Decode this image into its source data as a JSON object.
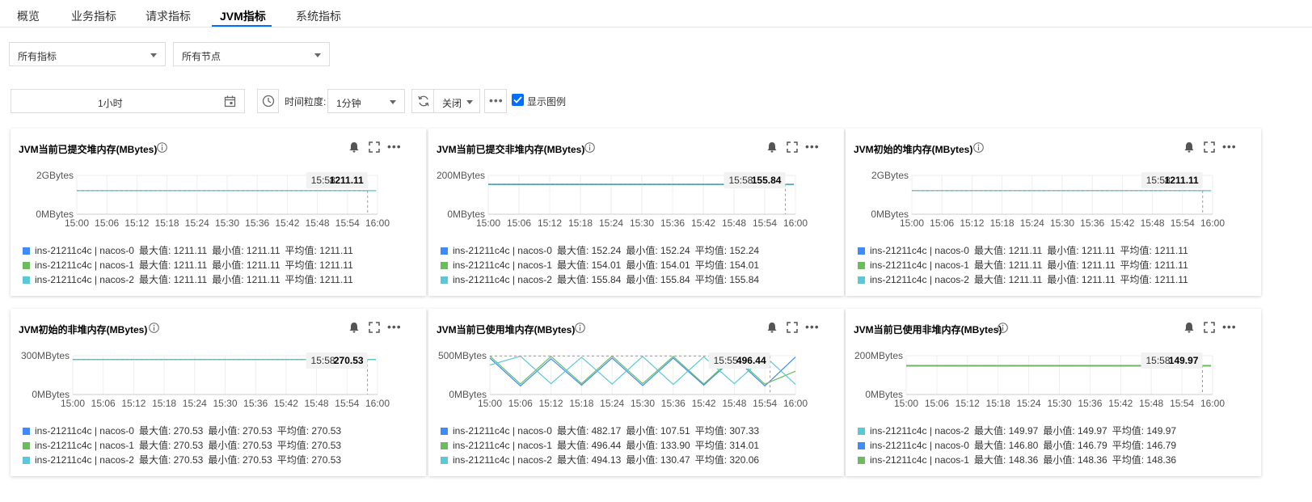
{
  "tabs": [
    "概览",
    "业务指标",
    "请求指标",
    "JVM指标",
    "系统指标"
  ],
  "active_tab": 3,
  "filters": {
    "metric_select": "所有指标",
    "node_select": "所有节点"
  },
  "toolbar": {
    "time_range": "1小时",
    "granularity_label": "时间粒度:",
    "granularity_value": "1分钟",
    "refresh_value": "关闭",
    "show_legend_label": "显示图例",
    "show_legend_checked": true
  },
  "colors": {
    "accent": "#006eff",
    "series": [
      "#3d8bfd",
      "#6cbc5e",
      "#5ac8d8"
    ]
  },
  "x_ticks": [
    "15:00",
    "15:06",
    "15:12",
    "15:18",
    "15:24",
    "15:30",
    "15:36",
    "15:42",
    "15:48",
    "15:54",
    "16:00"
  ],
  "cards": [
    {
      "title": "JVM当前已提交堆内存(MBytes)",
      "y_top": "2GBytes",
      "y_bottom": "0MBytes",
      "tooltip_time": "15:58",
      "tooltip_value": "1211.11",
      "legend": [
        {
          "name": "ins-21211c4c | nacos-0",
          "max": "最大值: 1211.11",
          "min": "最小值: 1211.11",
          "avg": "平均值: 1211.11"
        },
        {
          "name": "ins-21211c4c | nacos-1",
          "max": "最大值: 1211.11",
          "min": "最小值: 1211.11",
          "avg": "平均值: 1211.11"
        },
        {
          "name": "ins-21211c4c | nacos-2",
          "max": "最大值: 1211.11",
          "min": "最小值: 1211.11",
          "avg": "平均值: 1211.11"
        }
      ]
    },
    {
      "title": "JVM当前已提交非堆内存(MBytes)",
      "y_top": "200MBytes",
      "y_bottom": "0MBytes",
      "tooltip_time": "15:58",
      "tooltip_value": "155.84",
      "legend": [
        {
          "name": "ins-21211c4c | nacos-0",
          "max": "最大值: 152.24",
          "min": "最小值: 152.24",
          "avg": "平均值: 152.24"
        },
        {
          "name": "ins-21211c4c | nacos-1",
          "max": "最大值: 154.01",
          "min": "最小值: 154.01",
          "avg": "平均值: 154.01"
        },
        {
          "name": "ins-21211c4c | nacos-2",
          "max": "最大值: 155.84",
          "min": "最小值: 155.84",
          "avg": "平均值: 155.84"
        }
      ]
    },
    {
      "title": "JVM初始的堆内存(MBytes)",
      "y_top": "2GBytes",
      "y_bottom": "0MBytes",
      "tooltip_time": "15:58",
      "tooltip_value": "1211.11",
      "legend": [
        {
          "name": "ins-21211c4c | nacos-0",
          "max": "最大值: 1211.11",
          "min": "最小值: 1211.11",
          "avg": "平均值: 1211.11"
        },
        {
          "name": "ins-21211c4c | nacos-1",
          "max": "最大值: 1211.11",
          "min": "最小值: 1211.11",
          "avg": "平均值: 1211.11"
        },
        {
          "name": "ins-21211c4c | nacos-2",
          "max": "最大值: 1211.11",
          "min": "最小值: 1211.11",
          "avg": "平均值: 1211.11"
        }
      ]
    },
    {
      "title": "JVM初始的非堆内存(MBytes)",
      "y_top": "300MBytes",
      "y_bottom": "0MBytes",
      "tooltip_time": "15:58",
      "tooltip_value": "270.53",
      "legend": [
        {
          "name": "ins-21211c4c | nacos-0",
          "max": "最大值: 270.53",
          "min": "最小值: 270.53",
          "avg": "平均值: 270.53"
        },
        {
          "name": "ins-21211c4c | nacos-1",
          "max": "最大值: 270.53",
          "min": "最小值: 270.53",
          "avg": "平均值: 270.53"
        },
        {
          "name": "ins-21211c4c | nacos-2",
          "max": "最大值: 270.53",
          "min": "最小值: 270.53",
          "avg": "平均值: 270.53"
        }
      ]
    },
    {
      "title": "JVM当前已使用堆内存(MBytes)",
      "y_top": "500MBytes",
      "y_bottom": "0MBytes",
      "tooltip_time": "15:55",
      "tooltip_value": "496.44",
      "legend": [
        {
          "name": "ins-21211c4c | nacos-0",
          "max": "最大值: 482.17",
          "min": "最小值: 107.51",
          "avg": "平均值: 307.33"
        },
        {
          "name": "ins-21211c4c | nacos-1",
          "max": "最大值: 496.44",
          "min": "最小值: 133.90",
          "avg": "平均值: 314.01"
        },
        {
          "name": "ins-21211c4c | nacos-2",
          "max": "最大值: 494.13",
          "min": "最小值: 130.47",
          "avg": "平均值: 320.06"
        }
      ]
    },
    {
      "title": "JVM当前已使用非堆内存(MBytes)",
      "y_top": "200MBytes",
      "y_bottom": "0MBytes",
      "tooltip_time": "15:58",
      "tooltip_value": "149.97",
      "legend": [
        {
          "name": "ins-21211c4c | nacos-2",
          "max": "最大值: 149.97",
          "min": "最小值: 149.97",
          "avg": "平均值: 149.97"
        },
        {
          "name": "ins-21211c4c | nacos-0",
          "max": "最大值: 146.80",
          "min": "最小值: 146.79",
          "avg": "平均值: 146.79"
        },
        {
          "name": "ins-21211c4c | nacos-1",
          "max": "最大值: 148.36",
          "min": "最小值: 148.36",
          "avg": "平均值: 148.36"
        }
      ]
    }
  ],
  "chart_data": [
    {
      "type": "line",
      "title": "JVM当前已提交堆内存(MBytes)",
      "x": [
        "15:00",
        "15:06",
        "15:12",
        "15:18",
        "15:24",
        "15:30",
        "15:36",
        "15:42",
        "15:48",
        "15:54",
        "16:00"
      ],
      "ylim": [
        0,
        2000
      ],
      "series": [
        {
          "name": "ins-21211c4c | nacos-0",
          "values": [
            1211.11,
            1211.11,
            1211.11,
            1211.11,
            1211.11,
            1211.11,
            1211.11,
            1211.11,
            1211.11,
            1211.11
          ]
        },
        {
          "name": "ins-21211c4c | nacos-1",
          "values": [
            1211.11,
            1211.11,
            1211.11,
            1211.11,
            1211.11,
            1211.11,
            1211.11,
            1211.11,
            1211.11,
            1211.11
          ]
        },
        {
          "name": "ins-21211c4c | nacos-2",
          "values": [
            1211.11,
            1211.11,
            1211.11,
            1211.11,
            1211.11,
            1211.11,
            1211.11,
            1211.11,
            1211.11,
            1211.11
          ]
        }
      ]
    },
    {
      "type": "line",
      "title": "JVM当前已提交非堆内存(MBytes)",
      "x": [
        "15:00",
        "15:06",
        "15:12",
        "15:18",
        "15:24",
        "15:30",
        "15:36",
        "15:42",
        "15:48",
        "15:54",
        "16:00"
      ],
      "ylim": [
        0,
        200
      ],
      "series": [
        {
          "name": "ins-21211c4c | nacos-0",
          "values": [
            152.24,
            152.24,
            152.24,
            152.24,
            152.24,
            152.24,
            152.24,
            152.24,
            152.24,
            152.24
          ]
        },
        {
          "name": "ins-21211c4c | nacos-1",
          "values": [
            154.01,
            154.01,
            154.01,
            154.01,
            154.01,
            154.01,
            154.01,
            154.01,
            154.01,
            154.01
          ]
        },
        {
          "name": "ins-21211c4c | nacos-2",
          "values": [
            155.84,
            155.84,
            155.84,
            155.84,
            155.84,
            155.84,
            155.84,
            155.84,
            155.84,
            155.84
          ]
        }
      ]
    },
    {
      "type": "line",
      "title": "JVM初始的堆内存(MBytes)",
      "x": [
        "15:00",
        "15:06",
        "15:12",
        "15:18",
        "15:24",
        "15:30",
        "15:36",
        "15:42",
        "15:48",
        "15:54",
        "16:00"
      ],
      "ylim": [
        0,
        2000
      ],
      "series": [
        {
          "name": "ins-21211c4c | nacos-0",
          "values": [
            1211.11,
            1211.11,
            1211.11,
            1211.11,
            1211.11,
            1211.11,
            1211.11,
            1211.11,
            1211.11,
            1211.11
          ]
        },
        {
          "name": "ins-21211c4c | nacos-1",
          "values": [
            1211.11,
            1211.11,
            1211.11,
            1211.11,
            1211.11,
            1211.11,
            1211.11,
            1211.11,
            1211.11,
            1211.11
          ]
        },
        {
          "name": "ins-21211c4c | nacos-2",
          "values": [
            1211.11,
            1211.11,
            1211.11,
            1211.11,
            1211.11,
            1211.11,
            1211.11,
            1211.11,
            1211.11,
            1211.11
          ]
        }
      ]
    },
    {
      "type": "line",
      "title": "JVM初始的非堆内存(MBytes)",
      "x": [
        "15:00",
        "15:06",
        "15:12",
        "15:18",
        "15:24",
        "15:30",
        "15:36",
        "15:42",
        "15:48",
        "15:54",
        "16:00"
      ],
      "ylim": [
        0,
        300
      ],
      "series": [
        {
          "name": "ins-21211c4c | nacos-0",
          "values": [
            270.53,
            270.53,
            270.53,
            270.53,
            270.53,
            270.53,
            270.53,
            270.53,
            270.53,
            270.53
          ]
        },
        {
          "name": "ins-21211c4c | nacos-1",
          "values": [
            270.53,
            270.53,
            270.53,
            270.53,
            270.53,
            270.53,
            270.53,
            270.53,
            270.53,
            270.53
          ]
        },
        {
          "name": "ins-21211c4c | nacos-2",
          "values": [
            270.53,
            270.53,
            270.53,
            270.53,
            270.53,
            270.53,
            270.53,
            270.53,
            270.53,
            270.53
          ]
        }
      ]
    },
    {
      "type": "line",
      "title": "JVM当前已使用堆内存(MBytes)",
      "x": [
        "15:00",
        "15:06",
        "15:12",
        "15:18",
        "15:24",
        "15:30",
        "15:36",
        "15:42",
        "15:48",
        "15:54",
        "16:00"
      ],
      "ylim": [
        0,
        500
      ],
      "series": [
        {
          "name": "ins-21211c4c | nacos-0",
          "values": [
            470,
            110,
            460,
            120,
            470,
            115,
            470,
            120,
            475,
            110,
            482
          ]
        },
        {
          "name": "ins-21211c4c | nacos-1",
          "values": [
            496,
            135,
            490,
            140,
            495,
            140,
            490,
            135,
            496,
            134,
            300
          ]
        },
        {
          "name": "ins-21211c4c | nacos-2",
          "values": [
            380,
            494,
            140,
            480,
            135,
            490,
            130,
            485,
            140,
            494,
            131
          ]
        }
      ]
    },
    {
      "type": "line",
      "title": "JVM当前已使用非堆内存(MBytes)",
      "x": [
        "15:00",
        "15:06",
        "15:12",
        "15:18",
        "15:24",
        "15:30",
        "15:36",
        "15:42",
        "15:48",
        "15:54",
        "16:00"
      ],
      "ylim": [
        0,
        200
      ],
      "series": [
        {
          "name": "ins-21211c4c | nacos-2",
          "values": [
            149.97,
            149.97,
            149.97,
            149.97,
            149.97,
            149.97,
            149.97,
            149.97,
            149.97,
            149.97
          ]
        },
        {
          "name": "ins-21211c4c | nacos-0",
          "values": [
            146.79,
            146.79,
            146.79,
            146.79,
            146.79,
            146.79,
            146.79,
            146.79,
            146.79,
            146.8
          ]
        },
        {
          "name": "ins-21211c4c | nacos-1",
          "values": [
            148.36,
            148.36,
            148.36,
            148.36,
            148.36,
            148.36,
            148.36,
            148.36,
            148.36,
            148.36
          ]
        }
      ]
    }
  ]
}
